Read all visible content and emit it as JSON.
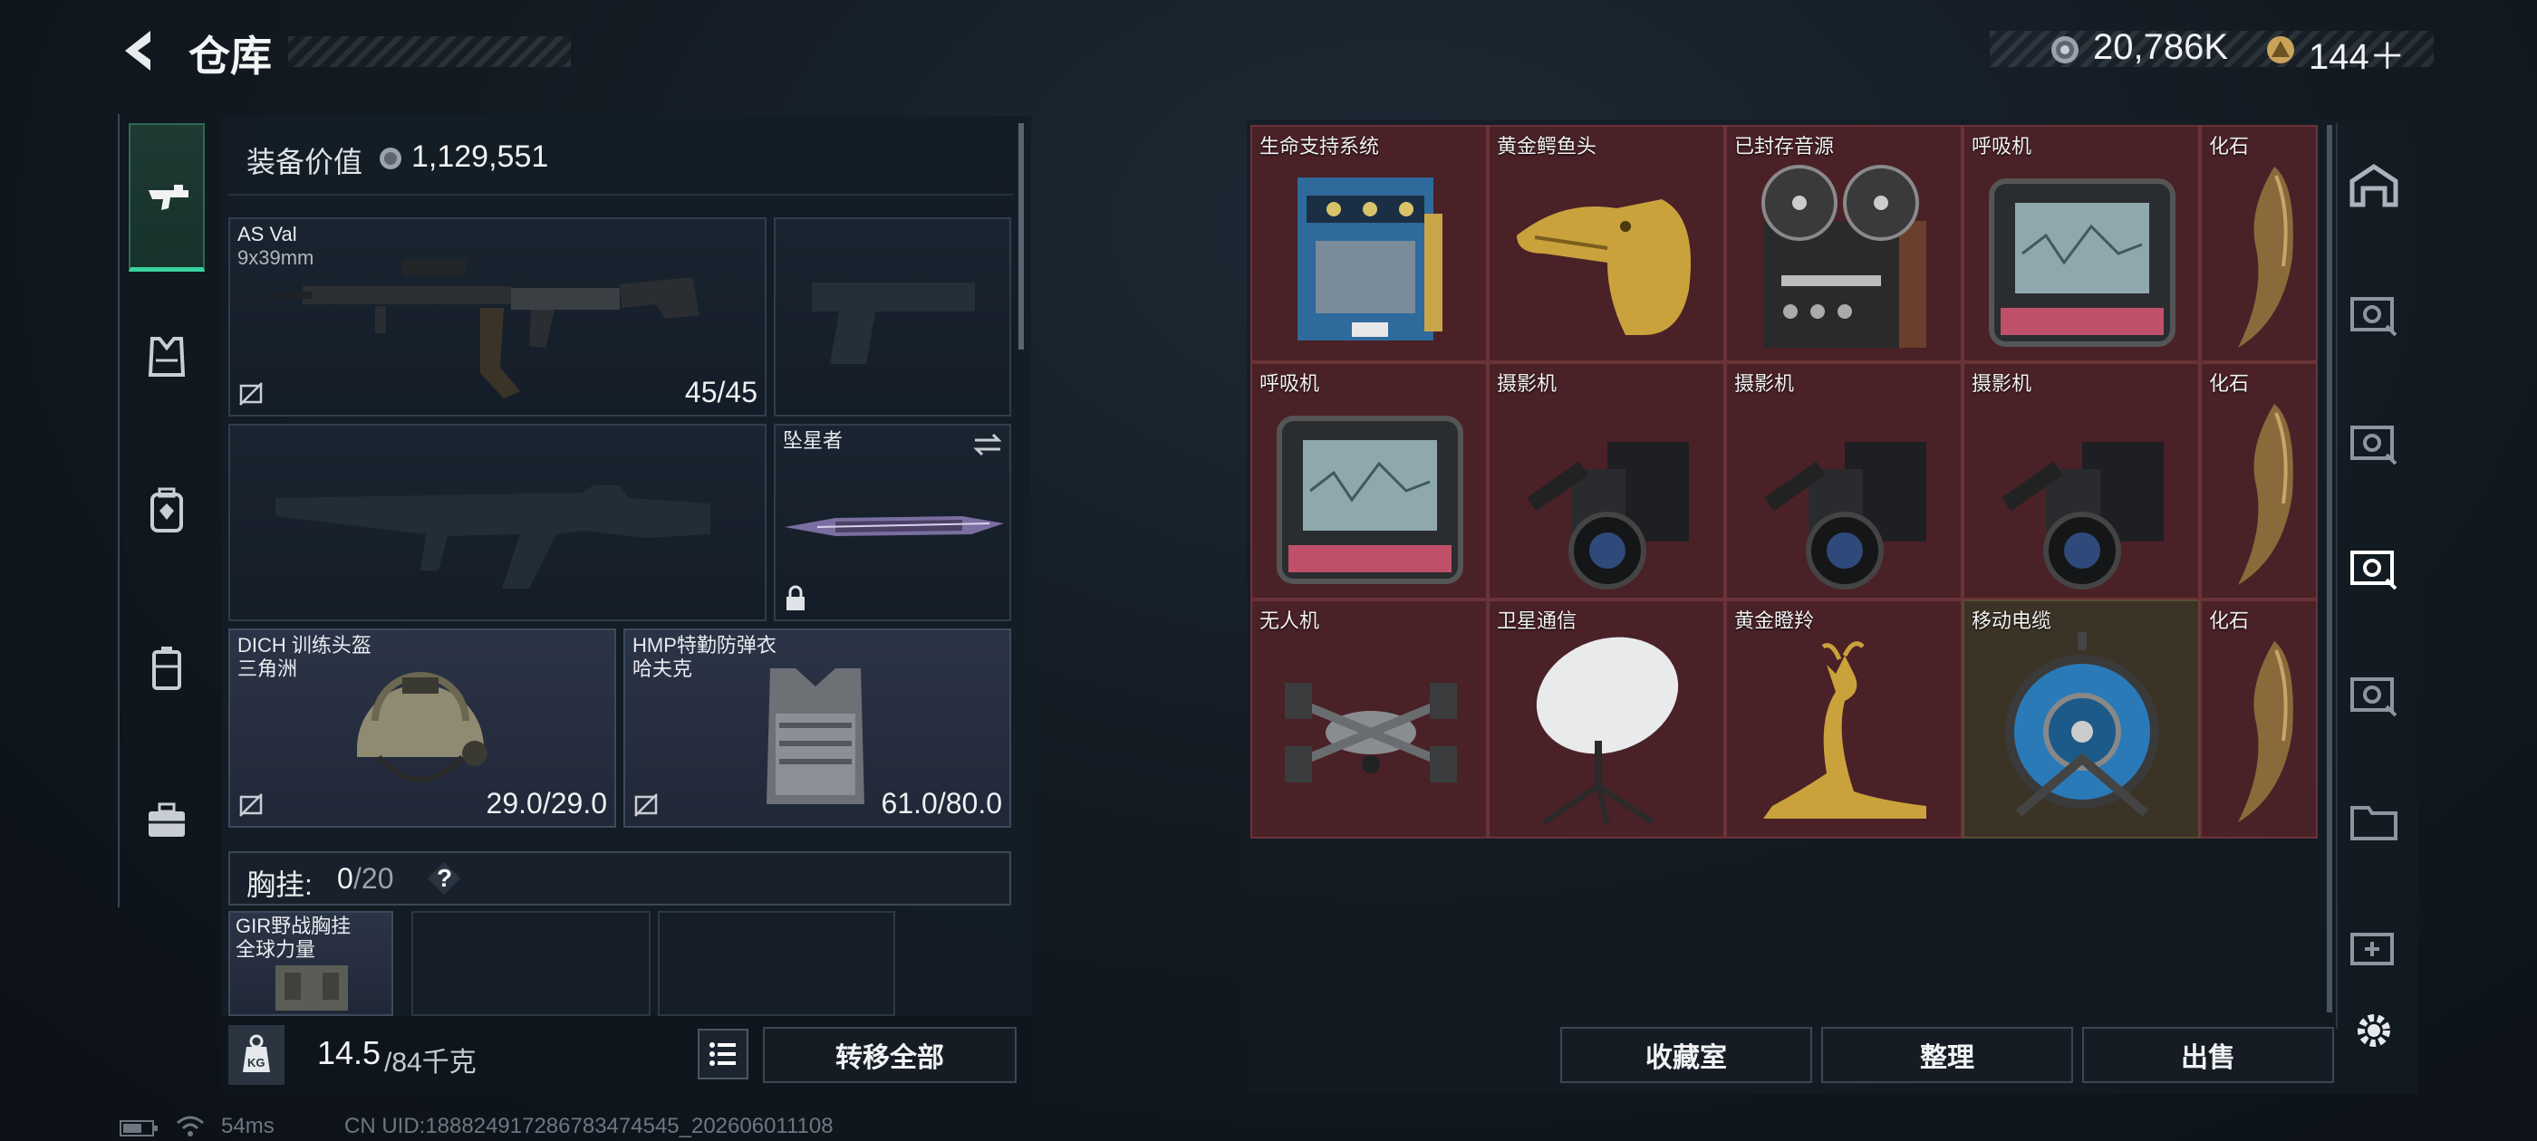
{
  "header": {
    "title": "仓库",
    "currency_coins": "20,786K",
    "currency_tokens": "144＋"
  },
  "left_panel": {
    "equipment_value_label": "装备价值",
    "equipment_value": "1,129,551",
    "primary_weapon": {
      "name": "AS Val",
      "ammo_type": "9x39mm",
      "ammo": "45/45"
    },
    "melee": {
      "name": "坠星者"
    },
    "helmet": {
      "name": "DICH 训练头盔",
      "brand": "三角洲",
      "durability": "29.0/29.0"
    },
    "armor": {
      "name": "HMP特勤防弹衣",
      "brand": "哈夫克",
      "durability": "61.0/80.0"
    },
    "chest_rig_label": "胸挂:",
    "chest_rig_count": "0",
    "chest_rig_capacity": "/20",
    "chest_rig_help": "?",
    "chest_rig_item": {
      "name": "GIR野战胸挂",
      "brand": "全球力量"
    },
    "weight_value": "14.5",
    "weight_unit": "/84千克",
    "weight_icon_text": "KG",
    "transfer_all": "转移全部"
  },
  "grid": {
    "rows": [
      [
        {
          "name": "生命支持系统",
          "icon": "life-support-system"
        },
        {
          "name": "黄金鳄鱼头",
          "icon": "golden-crocodile-head"
        },
        {
          "name": "已封存音源",
          "icon": "reel-to-reel-recorder"
        },
        {
          "name": "呼吸机",
          "icon": "ventilator"
        },
        {
          "name": "化石",
          "icon": "fossil-claw"
        }
      ],
      [
        {
          "name": "呼吸机",
          "icon": "ventilator"
        },
        {
          "name": "摄影机",
          "icon": "camera"
        },
        {
          "name": "摄影机",
          "icon": "camera"
        },
        {
          "name": "摄影机",
          "icon": "camera"
        },
        {
          "name": "化石",
          "icon": "fossil-claw"
        }
      ],
      [
        {
          "name": "无人机",
          "icon": "drone"
        },
        {
          "name": "卫星通信",
          "icon": "satellite-dish"
        },
        {
          "name": "黄金瞪羚",
          "icon": "golden-gazelle"
        },
        {
          "name": "移动电缆",
          "icon": "cable-reel"
        },
        {
          "name": "化石",
          "icon": "fossil-claw"
        }
      ]
    ]
  },
  "actions": {
    "collection": "收藏室",
    "organize": "整理",
    "sell": "出售"
  },
  "status": {
    "ping": "54ms",
    "uid": "CN UID:18882491728678347454​5_202606011108"
  },
  "colors": {
    "valuable_cell": "#4a2127",
    "gold_cell": "#3b3325",
    "accent_green": "#38d39f"
  }
}
